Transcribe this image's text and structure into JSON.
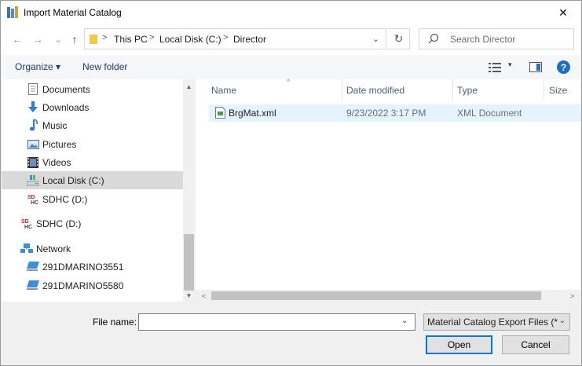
{
  "window": {
    "title": "Import Material Catalog",
    "close_glyph": "✕"
  },
  "nav": {
    "back_glyph": "←",
    "forward_glyph": "→",
    "recent_glyph": "⌄",
    "up_glyph": "↑",
    "refresh_glyph": "↻"
  },
  "address": {
    "breadcrumbs": [
      "This PC",
      "Local Disk (C:)",
      "Director"
    ],
    "separator": ">",
    "dropdown_glyph": "⌄"
  },
  "search": {
    "placeholder": "Search Director"
  },
  "toolbar": {
    "organize_label": "Organize ▾",
    "new_folder_label": "New folder",
    "view_dropdown": "▾",
    "help_glyph": "?"
  },
  "sidebar": {
    "items": [
      {
        "label": "Documents",
        "icon": "documents-icon",
        "selected": false
      },
      {
        "label": "Downloads",
        "icon": "downloads-icon",
        "selected": false
      },
      {
        "label": "Music",
        "icon": "music-icon",
        "selected": false
      },
      {
        "label": "Pictures",
        "icon": "pictures-icon",
        "selected": false
      },
      {
        "label": "Videos",
        "icon": "videos-icon",
        "selected": false
      },
      {
        "label": "Local Disk (C:)",
        "icon": "local-disk-icon",
        "selected": true
      },
      {
        "label": "SDHC (D:)",
        "icon": "sdhc-icon",
        "selected": false
      },
      {
        "label": "SDHC (D:)",
        "icon": "sdhc-icon",
        "selected": false
      },
      {
        "label": "Network",
        "icon": "network-icon",
        "selected": false
      },
      {
        "label": "291DMARINO3551",
        "icon": "computer-icon",
        "selected": false
      },
      {
        "label": "291DMARINO5580",
        "icon": "computer-icon",
        "selected": false
      }
    ],
    "scroll_up": "▲",
    "scroll_down": "▼"
  },
  "filelist": {
    "columns": [
      "Name",
      "Date modified",
      "Type",
      "Size"
    ],
    "sort_indicator": "^",
    "rows": [
      {
        "name": "BrgMat.xml",
        "date": "9/23/2022 3:17 PM",
        "type": "XML Document",
        "size": ""
      }
    ],
    "scroll_left": "<",
    "scroll_right": ">"
  },
  "footer": {
    "filename_label": "File name:",
    "filename_value": "",
    "filename_dropdown": "⌄",
    "filter_value": "Material Catalog Export Files (*",
    "filter_dropdown": "⌄",
    "open_label": "Open",
    "cancel_label": "Cancel"
  },
  "colors": {
    "accent": "#0078d7",
    "selection": "#e5f3ff",
    "folder": "#f3c944",
    "link": "#1e3a6e"
  }
}
